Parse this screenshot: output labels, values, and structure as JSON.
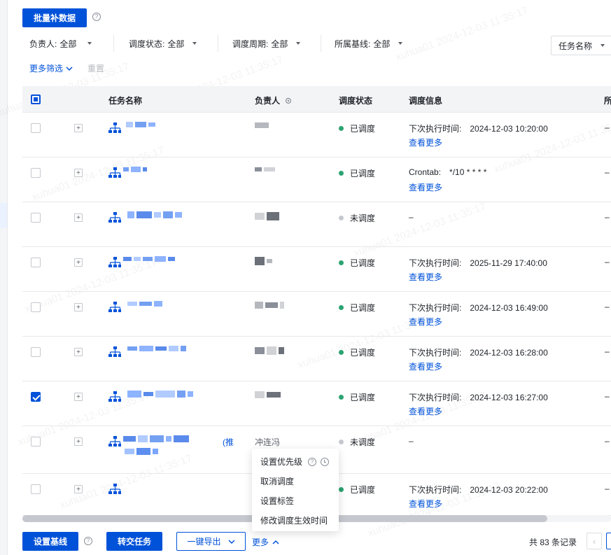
{
  "toolbar": {
    "backfill_button": "批量补数据",
    "search_select": "任务名称"
  },
  "filters": [
    {
      "label": "负责人:",
      "value": "全部"
    },
    {
      "label": "调度状态:",
      "value": "全部"
    },
    {
      "label": "调度周期:",
      "value": "全部"
    },
    {
      "label": "所属基线:",
      "value": "全部"
    }
  ],
  "filter_links": {
    "more_filters": "更多筛选",
    "reset": "重置"
  },
  "table": {
    "columns": [
      "任务名称",
      "负责人",
      "调度状态",
      "调度信息",
      "所"
    ],
    "view_more": "查看更多",
    "rows": [
      {
        "checked": false,
        "status": "已调度",
        "status_color": "#2ba471",
        "sched_label": "下次执行时间:",
        "sched_value": "2024-12-03 10:20:00",
        "has_more": true,
        "last": "–"
      },
      {
        "checked": false,
        "status": "已调度",
        "status_color": "#2ba471",
        "sched_label": "Crontab:",
        "sched_value": "*/10 * * * *",
        "has_more": true,
        "last": "–"
      },
      {
        "checked": false,
        "status": "未调度",
        "status_color": "#c5c8ce",
        "sched_label": "–",
        "sched_value": "",
        "has_more": false,
        "last": "–"
      },
      {
        "checked": false,
        "status": "已调度",
        "status_color": "#2ba471",
        "sched_label": "下次执行时间:",
        "sched_value": "2025-11-29 17:40:00",
        "has_more": true,
        "last": "–"
      },
      {
        "checked": false,
        "status": "已调度",
        "status_color": "#2ba471",
        "sched_label": "下次执行时间:",
        "sched_value": "2024-12-03 16:49:00",
        "has_more": true,
        "last": "–"
      },
      {
        "checked": false,
        "status": "已调度",
        "status_color": "#2ba471",
        "sched_label": "下次执行时间:",
        "sched_value": "2024-12-03 16:28:00",
        "has_more": true,
        "last": "–"
      },
      {
        "checked": true,
        "status": "已调度",
        "status_color": "#2ba471",
        "sched_label": "下次执行时间:",
        "sched_value": "2024-12-03 16:27:00",
        "has_more": true,
        "last": "–"
      },
      {
        "checked": false,
        "status": "未调度",
        "status_color": "#c5c8ce",
        "sched_label": "–",
        "sched_value": "",
        "has_more": false,
        "last": "–",
        "name_suffix": "(推",
        "owner_suffix": "冲连冯"
      },
      {
        "checked": false,
        "status": "已调度",
        "status_color": "#2ba471",
        "sched_label": "下次执行时间:",
        "sched_value": "2024-12-03 20:22:00",
        "has_more": true,
        "last": "–"
      }
    ]
  },
  "context_menu": {
    "items": [
      "设置优先级",
      "取消调度",
      "设置标签",
      "修改调度生效时间"
    ]
  },
  "bottom": {
    "set_baseline": "设置基线",
    "transfer": "转交任务",
    "export": "一键导出",
    "more": "更多",
    "total": "共 83 条记录"
  },
  "watermark": "xuhua01 2024-12-03 11:35:17",
  "colors": {
    "primary": "#0052d9",
    "scheduled": "#2ba471",
    "unscheduled": "#c5c8ce"
  }
}
